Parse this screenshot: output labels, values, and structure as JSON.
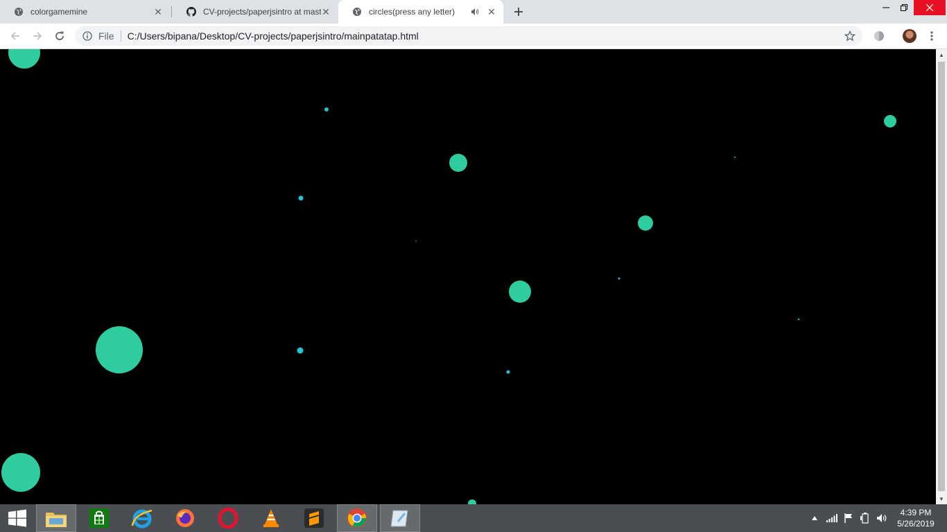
{
  "browser": {
    "tabs": [
      {
        "title": "colorgamemine",
        "favicon": "globe-icon",
        "active": false
      },
      {
        "title": "CV-projects/paperjsintro at mast",
        "favicon": "github-icon",
        "active": false
      },
      {
        "title": "circles(press any letter)",
        "favicon": "globe-icon",
        "active": true,
        "audio": "speaker-icon"
      }
    ],
    "omnibox": {
      "scheme_label": "File",
      "url": "C:/Users/bipana/Desktop/CV-projects/paperjsintro/mainpatatap.html"
    }
  },
  "page": {
    "background": "#000000",
    "circle_color": "#2ecc9e",
    "dot_color": "#22c4d4"
  },
  "taskbar": {
    "apps": [
      "windows-start-icon",
      "file-explorer-icon",
      "store-icon",
      "internet-explorer-icon",
      "firefox-icon",
      "opera-icon",
      "vlc-icon",
      "sublime-text-icon",
      "chrome-icon",
      "paint-icon"
    ],
    "clock": {
      "time": "4:39 PM",
      "date": "5/26/2019"
    }
  }
}
